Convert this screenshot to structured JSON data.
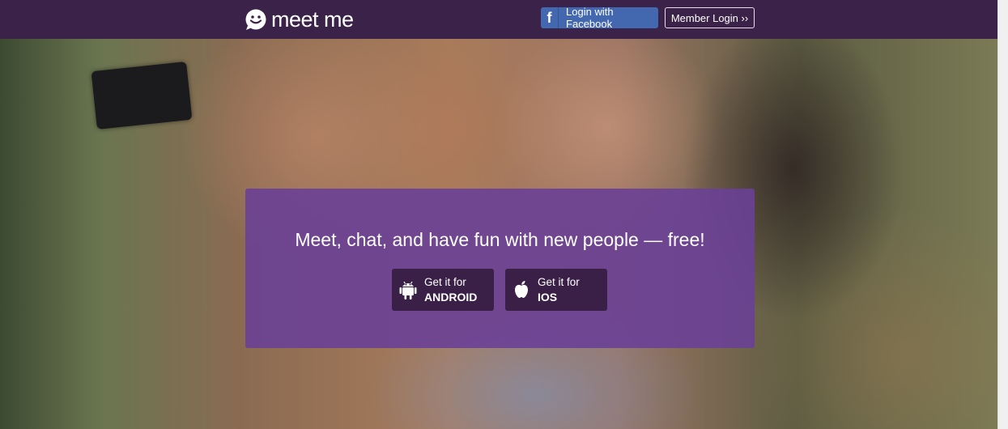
{
  "header": {
    "logo_text": "meet me",
    "facebook_icon_glyph": "f",
    "facebook_login_label": "Login with Facebook",
    "member_login_label": "Member Login ››",
    "bg_color": "#3b2248",
    "facebook_color": "#4468b0"
  },
  "hero": {
    "headline": "Meet, chat, and have fun with new people — free!",
    "card_color": "#6a4096",
    "android_button": {
      "line1": "Get it for",
      "line2": "ANDROID",
      "icon": "android-icon"
    },
    "ios_button": {
      "line1": "Get it for",
      "line2": "IOS",
      "icon": "apple-icon"
    }
  }
}
